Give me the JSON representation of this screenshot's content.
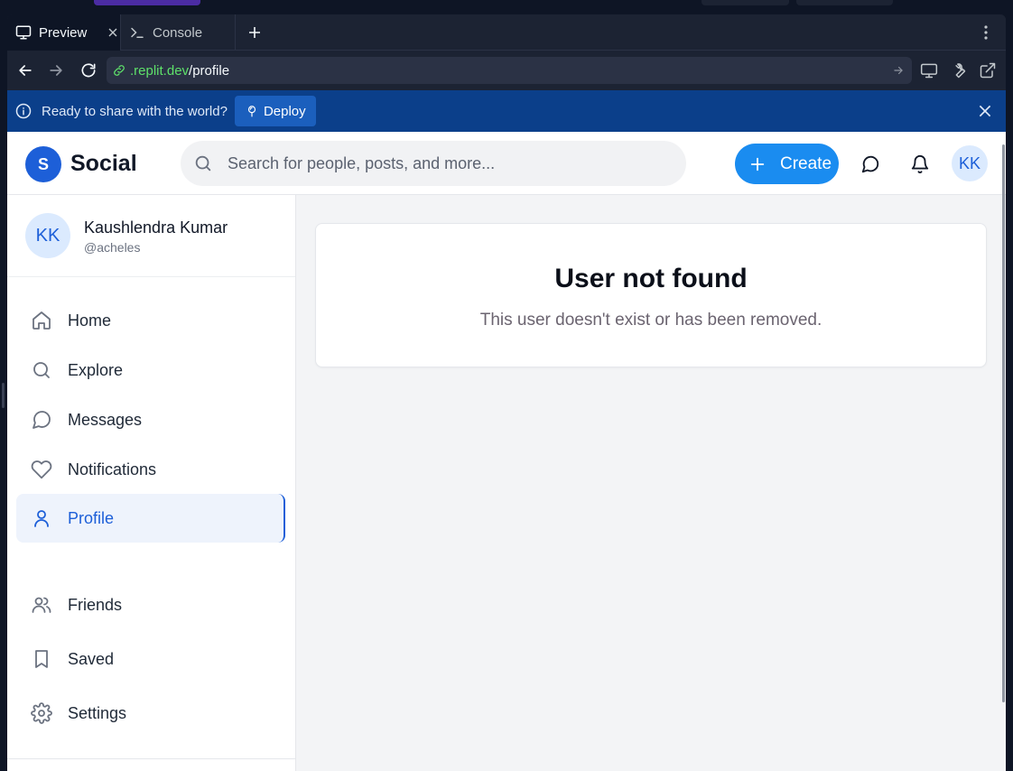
{
  "editor": {
    "tabs": [
      {
        "label": "Preview",
        "icon": "monitor-icon"
      },
      {
        "label": "Console",
        "icon": "terminal-icon"
      }
    ],
    "url": {
      "domain": ".replit.dev",
      "path": "/profile"
    },
    "banner": {
      "text": "Ready to share with the world?",
      "deploy_label": "Deploy"
    },
    "colors": {
      "pane": "#1c2333",
      "banner": "#0b3f8a",
      "url_domain": "#5ee16a"
    }
  },
  "app": {
    "logo": {
      "initial": "S",
      "name": "Social"
    },
    "search": {
      "placeholder": "Search for people, posts, and more..."
    },
    "create_label": "Create",
    "avatar_initials": "KK",
    "colors": {
      "brand": "#1d5fd8",
      "create": "#1a8cf0",
      "background": "#f3f4f6"
    }
  },
  "sidebar": {
    "user": {
      "initials": "KK",
      "name": "Kaushlendra Kumar",
      "handle": "@acheles"
    },
    "items": [
      {
        "label": "Home",
        "icon": "home-icon",
        "active": false
      },
      {
        "label": "Explore",
        "icon": "search-icon",
        "active": false
      },
      {
        "label": "Messages",
        "icon": "message-icon",
        "active": false
      },
      {
        "label": "Notifications",
        "icon": "heart-icon",
        "active": false
      },
      {
        "label": "Profile",
        "icon": "user-icon",
        "active": true
      },
      {
        "label": "Friends",
        "icon": "users-icon",
        "active": false
      },
      {
        "label": "Saved",
        "icon": "bookmark-icon",
        "active": false
      },
      {
        "label": "Settings",
        "icon": "gear-icon",
        "active": false
      }
    ]
  },
  "main": {
    "title": "User not found",
    "message": "This user doesn't exist or has been removed."
  }
}
